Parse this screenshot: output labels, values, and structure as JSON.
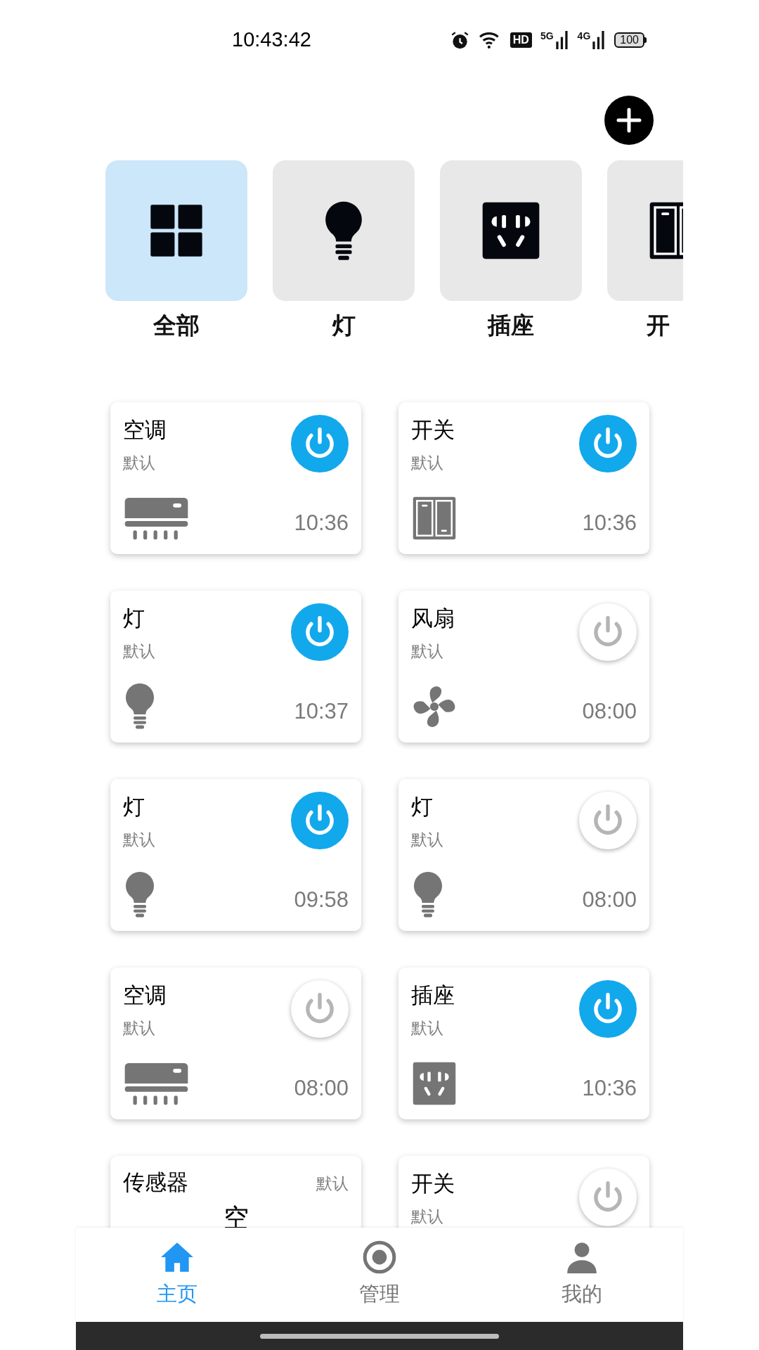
{
  "status_bar": {
    "time": "10:43:42",
    "hd": "HD",
    "signal_1": "5G",
    "signal_2": "4G",
    "battery": "100"
  },
  "categories": [
    {
      "label": "全部",
      "kind": "grid",
      "selected": true
    },
    {
      "label": "灯",
      "kind": "bulb",
      "selected": false
    },
    {
      "label": "插座",
      "kind": "socket",
      "selected": false
    },
    {
      "label": "开",
      "kind": "switch",
      "selected": false
    }
  ],
  "devices": [
    {
      "kind": "ac",
      "name": "空调",
      "group": "默认",
      "time": "10:36",
      "on": true
    },
    {
      "kind": "switch",
      "name": "开关",
      "group": "默认",
      "time": "10:36",
      "on": true
    },
    {
      "kind": "bulb",
      "name": "灯",
      "group": "默认",
      "time": "10:37",
      "on": true
    },
    {
      "kind": "fan",
      "name": "风扇",
      "group": "默认",
      "time": "08:00",
      "on": false
    },
    {
      "kind": "bulb",
      "name": "灯",
      "group": "默认",
      "time": "09:58",
      "on": true
    },
    {
      "kind": "bulb",
      "name": "灯",
      "group": "默认",
      "time": "08:00",
      "on": false
    },
    {
      "kind": "ac",
      "name": "空调",
      "group": "默认",
      "time": "08:00",
      "on": false
    },
    {
      "kind": "socket",
      "name": "插座",
      "group": "默认",
      "time": "10:36",
      "on": true
    },
    {
      "kind": "sensor",
      "name": "传感器",
      "group": "默认",
      "value": "空"
    },
    {
      "kind": "switch",
      "name": "开关",
      "group": "默认",
      "on": false
    }
  ],
  "nav": [
    {
      "label": "主页",
      "kind": "home",
      "selected": true
    },
    {
      "label": "管理",
      "kind": "target",
      "selected": false
    },
    {
      "label": "我的",
      "kind": "person",
      "selected": false
    }
  ]
}
